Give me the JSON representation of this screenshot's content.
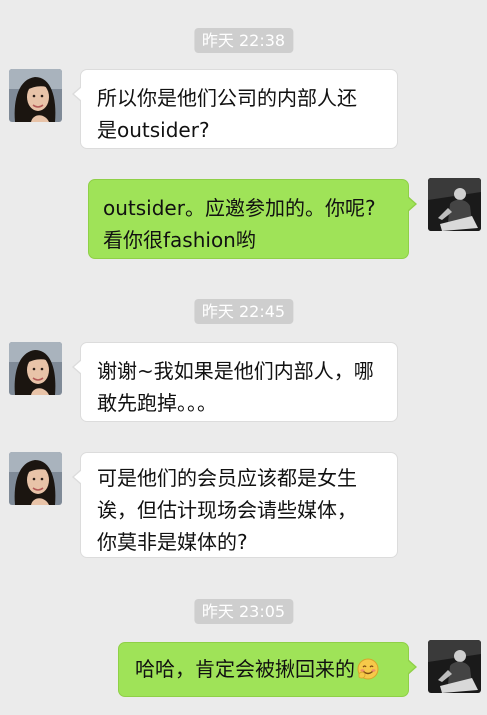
{
  "colors": {
    "background": "#ebebeb",
    "timestamp_pill": "#cecece",
    "incoming_bubble": "#ffffff",
    "outgoing_bubble": "#9fe358"
  },
  "timestamps": [
    "昨天 22:38",
    "昨天 22:45",
    "昨天 23:05"
  ],
  "messages": [
    {
      "sender": "contact",
      "text": "所以你是他们公司的内部人还\n是outsider?"
    },
    {
      "sender": "me",
      "text": "outsider。应邀参加的。你呢?\n看你很fashion哟"
    },
    {
      "sender": "contact",
      "text": "谢谢~我如果是他们内部人，哪\n敢先跑掉。。。"
    },
    {
      "sender": "contact",
      "text": "可是他们的会员应该都是女生\n诶，但估计现场会请些媒体，\n你莫非是媒体的?"
    },
    {
      "sender": "me",
      "text": "哈哈，肯定会被揪回来的",
      "emoji": "shy-laugh-emoji"
    }
  ]
}
